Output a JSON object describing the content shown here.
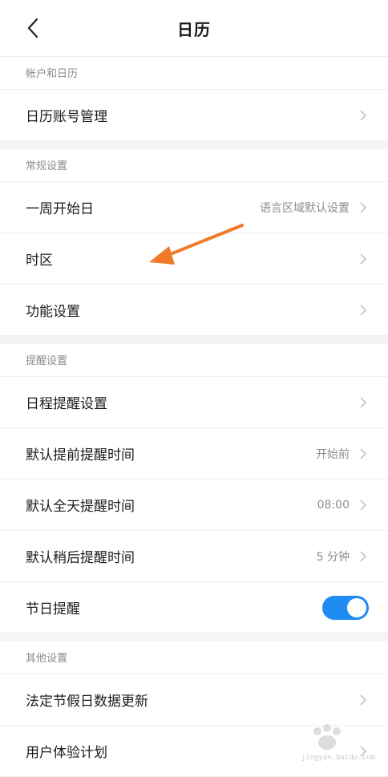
{
  "header": {
    "title": "日历",
    "back_icon": "chevron-left-icon"
  },
  "sections": [
    {
      "title": "帐户和日历",
      "rows": [
        {
          "label": "日历账号管理",
          "value": ""
        }
      ]
    },
    {
      "title": "常规设置",
      "rows": [
        {
          "label": "一周开始日",
          "value": "语言区域默认设置"
        },
        {
          "label": "时区",
          "value": ""
        },
        {
          "label": "功能设置",
          "value": ""
        }
      ]
    },
    {
      "title": "提醒设置",
      "rows": [
        {
          "label": "日程提醒设置",
          "value": ""
        },
        {
          "label": "默认提前提醒时间",
          "value": "开始前"
        },
        {
          "label": "默认全天提醒时间",
          "value": "08:00"
        },
        {
          "label": "默认稍后提醒时间",
          "value": "5 分钟"
        },
        {
          "label": "节日提醒",
          "toggle": true
        }
      ]
    },
    {
      "title": "其他设置",
      "rows": [
        {
          "label": "法定节假日数据更新",
          "value": ""
        },
        {
          "label": "用户体验计划",
          "value": ""
        }
      ]
    }
  ],
  "colors": {
    "accent": "#1e8cf0",
    "annotation": "#f07a2a"
  },
  "watermark": {
    "text": "jingyan.baidu.com"
  }
}
